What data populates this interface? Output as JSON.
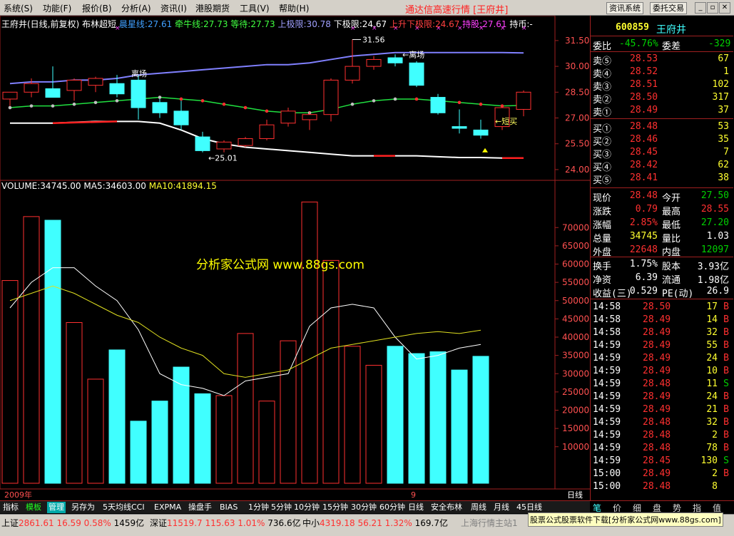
{
  "menu": {
    "items": [
      "系统(S)",
      "功能(F)",
      "报价(B)",
      "分析(A)",
      "资讯(I)",
      "港股期货",
      "工具(V)",
      "帮助(H)"
    ],
    "title": "通达信高速行情 [王府井]",
    "btn_news": "资讯系统",
    "btn_trade": "委托交易"
  },
  "chart_header": {
    "stock": "王府井(日线,前复权)",
    "indicator": "布林超短",
    "items": [
      {
        "label": "晨星线:27.61",
        "color": "#40a0ff"
      },
      {
        "label": "牵牛线:27.73",
        "color": "#40ff40"
      },
      {
        "label": "等待:27.73",
        "color": "#40ff40"
      },
      {
        "label": "上极限:30.78",
        "color": "#a0a0ff"
      },
      {
        "label": "下极限:24.67",
        "color": "#ffffff"
      },
      {
        "label": "上升下极限:24.67",
        "color": "#ff4040"
      },
      {
        "label": "持股:27.61",
        "color": "#ff40ff"
      },
      {
        "label": "持币:-",
        "color": "#ffffff"
      }
    ]
  },
  "volume_header": {
    "vol": "VOLUME:34745.00",
    "ma5": "MA5:34603.00",
    "ma10": "MA10:41894.15"
  },
  "watermark": "分析家公式网 www.88gs.com",
  "annotations": {
    "high": "31.56",
    "low": "←25.01",
    "escape1": "离场",
    "escape2": "←离场",
    "short_buy": "←短买"
  },
  "chart_data": {
    "type": "candlestick",
    "price_axis": {
      "ticks": [
        "31.50",
        "30.00",
        "28.50",
        "27.00",
        "25.50",
        "24.00"
      ],
      "ylim": [
        23.5,
        32.2
      ]
    },
    "volume_axis": {
      "ticks": [
        "70000",
        "65000",
        "60000",
        "55000",
        "50000",
        "45000",
        "40000",
        "35000",
        "30000",
        "25000",
        "20000",
        "15000",
        "10000"
      ],
      "ylim": [
        0,
        80000
      ]
    },
    "x_labels": [
      {
        "label": "2009年",
        "index": 0
      },
      {
        "label": "9",
        "index": 19
      }
    ],
    "candles": [
      {
        "o": 28.1,
        "h": 28.5,
        "l": 27.7,
        "c": 28.5
      },
      {
        "o": 28.5,
        "h": 29.3,
        "l": 28.2,
        "c": 29.0
      },
      {
        "o": 28.7,
        "h": 30.0,
        "l": 28.4,
        "c": 28.2
      },
      {
        "o": 28.6,
        "h": 29.3,
        "l": 28.0,
        "c": 29.2
      },
      {
        "o": 28.9,
        "h": 29.4,
        "l": 28.5,
        "c": 29.3
      },
      {
        "o": 29.0,
        "h": 29.5,
        "l": 28.2,
        "c": 28.4
      },
      {
        "o": 29.2,
        "h": 29.5,
        "l": 26.9,
        "c": 27.6
      },
      {
        "o": 27.9,
        "h": 28.1,
        "l": 27.0,
        "c": 27.3
      },
      {
        "o": 27.4,
        "h": 28.0,
        "l": 26.3,
        "c": 26.6
      },
      {
        "o": 25.9,
        "h": 26.2,
        "l": 25.0,
        "c": 25.1
      },
      {
        "o": 25.2,
        "h": 25.7,
        "l": 25.0,
        "c": 25.6
      },
      {
        "o": 25.4,
        "h": 25.9,
        "l": 25.3,
        "c": 25.8
      },
      {
        "o": 25.8,
        "h": 26.9,
        "l": 25.7,
        "c": 26.6
      },
      {
        "o": 26.7,
        "h": 27.6,
        "l": 26.5,
        "c": 27.4
      },
      {
        "o": 26.9,
        "h": 27.4,
        "l": 26.3,
        "c": 27.2
      },
      {
        "o": 27.2,
        "h": 29.3,
        "l": 26.8,
        "c": 29.2
      },
      {
        "o": 29.2,
        "h": 31.56,
        "l": 29.0,
        "c": 30.0
      },
      {
        "o": 30.0,
        "h": 30.6,
        "l": 29.8,
        "c": 30.4
      },
      {
        "o": 30.5,
        "h": 30.7,
        "l": 30.0,
        "c": 30.2
      },
      {
        "o": 30.2,
        "h": 30.3,
        "l": 28.8,
        "c": 28.9
      },
      {
        "o": 28.2,
        "h": 28.4,
        "l": 27.2,
        "c": 27.3
      },
      {
        "o": 26.5,
        "h": 27.5,
        "l": 26.1,
        "c": 26.4
      },
      {
        "o": 26.3,
        "h": 26.9,
        "l": 25.8,
        "c": 26.0
      },
      {
        "o": 26.5,
        "h": 27.7,
        "l": 26.3,
        "c": 27.6
      },
      {
        "o": 27.5,
        "h": 28.6,
        "l": 27.1,
        "c": 28.5
      }
    ],
    "volumes": [
      55500,
      73000,
      72000,
      44000,
      28500,
      36500,
      17000,
      22500,
      31800,
      24500,
      24000,
      41000,
      22500,
      39000,
      77000,
      61000,
      37500,
      32300,
      37500,
      35500,
      36000,
      31000,
      34745
    ],
    "volumes_full": [
      55500,
      73000,
      72000,
      44000,
      28500,
      36500,
      17000,
      22500,
      31800,
      24500,
      24000,
      41000,
      22500,
      39000,
      77000,
      61000,
      37500,
      32300,
      37500,
      35500,
      36000,
      31000,
      34745
    ],
    "upper_band": [
      29.0,
      29.1,
      29.1,
      29.2,
      29.2,
      29.3,
      29.5,
      29.6,
      29.7,
      29.8,
      29.9,
      30.0,
      30.1,
      30.1,
      30.2,
      30.4,
      30.6,
      30.7,
      30.8,
      30.8,
      30.8,
      30.8,
      30.8,
      30.8,
      30.78
    ],
    "lower_band": [
      26.7,
      26.7,
      26.7,
      26.75,
      26.8,
      26.8,
      26.8,
      26.7,
      26.3,
      25.8,
      25.5,
      25.3,
      25.2,
      25.1,
      25.0,
      24.9,
      24.8,
      24.8,
      24.8,
      24.8,
      24.75,
      24.7,
      24.7,
      24.67,
      24.67
    ],
    "mid_line": [
      27.6,
      27.7,
      27.7,
      27.8,
      27.9,
      28.0,
      28.1,
      28.2,
      28.1,
      28.0,
      27.8,
      27.6,
      27.4,
      27.3,
      27.3,
      27.5,
      27.8,
      28.0,
      28.1,
      28.1,
      28.0,
      27.9,
      27.8,
      27.7,
      27.73
    ],
    "vol_ma5": [
      48000,
      55000,
      59000,
      59000,
      54000,
      50000,
      42000,
      30000,
      27000,
      26000,
      24000,
      28000,
      29000,
      30000,
      43000,
      48000,
      49000,
      48000,
      40000,
      34000,
      35000,
      37000,
      38000
    ],
    "vol_ma10": [
      50000,
      52000,
      54000,
      52000,
      49000,
      46000,
      44000,
      40000,
      37000,
      35000,
      30000,
      29000,
      30000,
      31000,
      34000,
      37000,
      38000,
      39000,
      40000,
      41000,
      41500,
      41000,
      41894
    ]
  },
  "quote": {
    "code": "600859",
    "name": "王府井",
    "weibi_label": "委比",
    "weibi": "-45.76%",
    "weicha_label": "委差",
    "weicha": "-329",
    "sells": [
      {
        "label": "卖⑤",
        "price": "28.53",
        "vol": "67"
      },
      {
        "label": "卖④",
        "price": "28.52",
        "vol": "1"
      },
      {
        "label": "卖③",
        "price": "28.51",
        "vol": "102"
      },
      {
        "label": "卖②",
        "price": "28.50",
        "vol": "317"
      },
      {
        "label": "卖①",
        "price": "28.49",
        "vol": "37"
      }
    ],
    "buys": [
      {
        "label": "买①",
        "price": "28.48",
        "vol": "53"
      },
      {
        "label": "买②",
        "price": "28.46",
        "vol": "35"
      },
      {
        "label": "买③",
        "price": "28.45",
        "vol": "7"
      },
      {
        "label": "买④",
        "price": "28.42",
        "vol": "62"
      },
      {
        "label": "买⑤",
        "price": "28.41",
        "vol": "38"
      }
    ],
    "stats": [
      {
        "l1": "现价",
        "v1": "28.48",
        "l2": "今开",
        "v2": "27.50",
        "c1": "red",
        "c2": "grn"
      },
      {
        "l1": "涨跌",
        "v1": "0.79",
        "l2": "最高",
        "v2": "28.55",
        "c1": "red",
        "c2": "red"
      },
      {
        "l1": "涨幅",
        "v1": "2.85%",
        "l2": "最低",
        "v2": "27.20",
        "c1": "red",
        "c2": "grn"
      },
      {
        "l1": "总量",
        "v1": "34745",
        "l2": "量比",
        "v2": "1.03",
        "c1": "ylw",
        "c2": "wht"
      },
      {
        "l1": "外盘",
        "v1": "22648",
        "l2": "内盘",
        "v2": "12097",
        "c1": "red",
        "c2": "grn"
      }
    ],
    "stats2": [
      {
        "l1": "换手",
        "v1": "1.75%",
        "l2": "股本",
        "v2": "3.93亿"
      },
      {
        "l1": "净资",
        "v1": "6.39",
        "l2": "流通",
        "v2": "1.98亿"
      },
      {
        "l1": "收益(三)",
        "v1": "0.529",
        "l2": "PE(动)",
        "v2": "26.9"
      }
    ],
    "ticks": [
      {
        "t": "14:58",
        "p": "28.50",
        "v": "17",
        "s": "B"
      },
      {
        "t": "14:58",
        "p": "28.49",
        "v": "14",
        "s": "B"
      },
      {
        "t": "14:58",
        "p": "28.49",
        "v": "32",
        "s": "B"
      },
      {
        "t": "14:59",
        "p": "28.49",
        "v": "55",
        "s": "B"
      },
      {
        "t": "14:59",
        "p": "28.49",
        "v": "24",
        "s": "B"
      },
      {
        "t": "14:59",
        "p": "28.49",
        "v": "10",
        "s": "B"
      },
      {
        "t": "14:59",
        "p": "28.48",
        "v": "11",
        "s": "S"
      },
      {
        "t": "14:59",
        "p": "28.49",
        "v": "24",
        "s": "B"
      },
      {
        "t": "14:59",
        "p": "28.49",
        "v": "21",
        "s": "B"
      },
      {
        "t": "14:59",
        "p": "28.48",
        "v": "32",
        "s": "B"
      },
      {
        "t": "14:59",
        "p": "28.48",
        "v": "2",
        "s": "B"
      },
      {
        "t": "14:59",
        "p": "28.48",
        "v": "78",
        "s": "B"
      },
      {
        "t": "14:59",
        "p": "28.45",
        "v": "130",
        "s": "S"
      },
      {
        "t": "15:00",
        "p": "28.49",
        "v": "2",
        "s": "B"
      },
      {
        "t": "15:00",
        "p": "28.48",
        "v": "8",
        "s": ""
      }
    ]
  },
  "tabs": [
    "指标",
    "模板",
    "管理",
    "另存为",
    "5天均线",
    "CCI",
    "EXPMA",
    "操盘手",
    "BIAS",
    "1分钟",
    "5分钟",
    "10分钟",
    "15分钟",
    "30分钟",
    "60分钟",
    "日线",
    "安全布林",
    "周线",
    "月线",
    "45日线"
  ],
  "period_label": "日线",
  "panel_tabs": [
    "笔",
    "价",
    "细",
    "盘",
    "势",
    "指",
    "值"
  ],
  "status": {
    "sh_label": "上证",
    "sh_val": "2861.61",
    "sh_chg": "16.59",
    "sh_pct": "0.58%",
    "sh_amt": "1459亿",
    "sz_label": "深证",
    "sz_val": "11519.7",
    "sz_chg": "115.63",
    "sz_pct": "1.01%",
    "sz_amt": "736.6亿",
    "zx_label": "中小",
    "zx_val": "4319.18",
    "zx_chg": "56.21",
    "zx_pct": "1.32%",
    "zx_amt": "169.7亿",
    "server": "上海行情主站1",
    "ad": "股票公式股票软件下载[分析家公式网www.88gs.com]"
  }
}
